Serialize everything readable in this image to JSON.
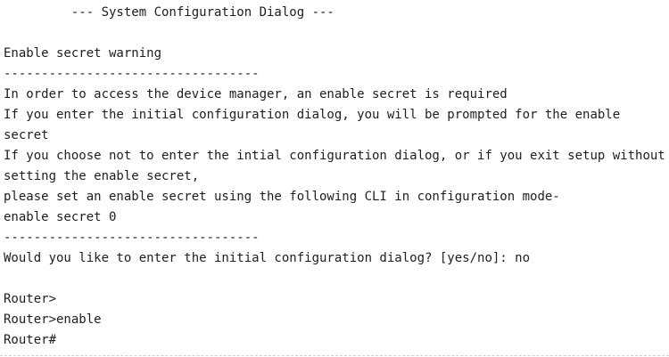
{
  "terminal": {
    "header": "         --- System Configuration Dialog ---",
    "blank": "",
    "warning_title": "Enable secret warning",
    "separator_1": "----------------------------------",
    "msg_line_1": "In order to access the device manager, an enable secret is required",
    "msg_line_2": "If you enter the initial configuration dialog, you will be prompted for the enable secret",
    "msg_line_3": "If you choose not to enter the intial configuration dialog, or if you exit setup without setting the enable secret,",
    "msg_line_4": "please set an enable secret using the following CLI in configuration mode-",
    "msg_line_5": "enable secret 0",
    "separator_2": "----------------------------------",
    "prompt_question": "Would you like to enter the initial configuration dialog? [yes/no]: no",
    "router_prompt_1": "Router>",
    "router_prompt_2": "Router>enable",
    "router_prompt_3": "Router#"
  }
}
